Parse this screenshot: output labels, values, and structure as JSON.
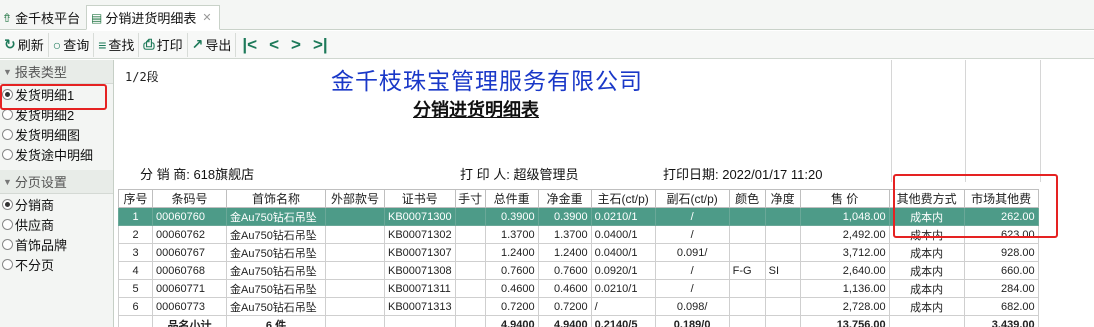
{
  "tabs": {
    "home_label": "金千枝平台",
    "active_label": "分销进货明细表"
  },
  "toolbar": {
    "refresh": "刷新",
    "query": "查询",
    "find": "查找",
    "print": "打印",
    "export": "导出"
  },
  "sidebar": {
    "report_type_title": "报表类型",
    "report_types": [
      "发货明细1",
      "发货明细2",
      "发货明细图",
      "发货途中明细"
    ],
    "report_type_selected": "发货明细1",
    "paging_title": "分页设置",
    "paging_options": [
      "分销商",
      "供应商",
      "首饰品牌",
      "不分页"
    ],
    "paging_selected": "分销商"
  },
  "report": {
    "page_info": "1/2段",
    "company": "金千枝珠宝管理服务有限公司",
    "title": "分销进货明细表",
    "distributor": "分 销 商: 618旗舰店",
    "printer": "打 印 人: 超级管理员",
    "print_date": "打印日期: 2022/01/17 11:20"
  },
  "table": {
    "headers": [
      "序号",
      "条码号",
      "首饰名称",
      "外部款号",
      "证书号",
      "手寸",
      "总件重",
      "净金重",
      "主石(ct/p)",
      "副石(ct/p)",
      "颜色",
      "净度",
      "售 价",
      "其他费方式",
      "市场其他费"
    ],
    "rows": [
      [
        "1",
        "00060760",
        "金Au750钻石吊坠",
        "",
        "KB00071300",
        "",
        "0.3900",
        "0.3900",
        "0.0210/1",
        "/",
        "",
        "",
        "1,048.00",
        "成本内",
        "262.00"
      ],
      [
        "2",
        "00060762",
        "金Au750钻石吊坠",
        "",
        "KB00071302",
        "",
        "1.3700",
        "1.3700",
        "0.0400/1",
        "/",
        "",
        "",
        "2,492.00",
        "成本内",
        "623.00"
      ],
      [
        "3",
        "00060767",
        "金Au750钻石吊坠",
        "",
        "KB00071307",
        "",
        "1.2400",
        "1.2400",
        "0.0400/1",
        "0.091/",
        "",
        "",
        "3,712.00",
        "成本内",
        "928.00"
      ],
      [
        "4",
        "00060768",
        "金Au750钻石吊坠",
        "",
        "KB00071308",
        "",
        "0.7600",
        "0.7600",
        "0.0920/1",
        "/",
        "F-G",
        "SI",
        "2,640.00",
        "成本内",
        "660.00"
      ],
      [
        "5",
        "00060771",
        "金Au750钻石吊坠",
        "",
        "KB00071311",
        "",
        "0.4600",
        "0.4600",
        "0.0210/1",
        "/",
        "",
        "",
        "1,136.00",
        "成本内",
        "284.00"
      ],
      [
        "6",
        "00060773",
        "金Au750钻石吊坠",
        "",
        "KB00071313",
        "",
        "0.7200",
        "0.7200",
        "/",
        "0.098/",
        "",
        "",
        "2,728.00",
        "成本内",
        "682.00"
      ]
    ],
    "subtotal": [
      "",
      "品名小计",
      "6 件",
      "",
      "",
      "",
      "4.9400",
      "4.9400",
      "0.2140/5",
      "0.189/0",
      "",
      "",
      "13,756.00",
      "",
      "3,439.00"
    ]
  }
}
